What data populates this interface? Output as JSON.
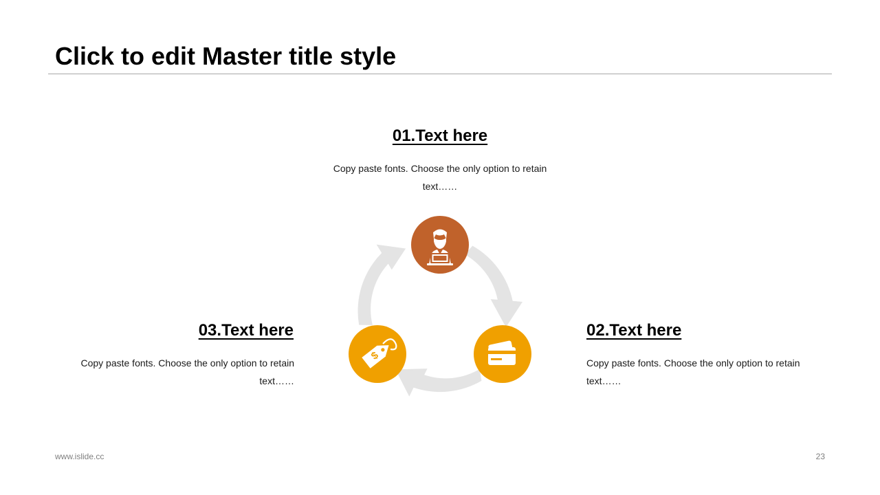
{
  "slide": {
    "title": "Click to edit Master title style"
  },
  "items": [
    {
      "heading": "01.Text here",
      "body": "Copy paste fonts. Choose the only option to retain text……",
      "icon": "person-laptop-icon",
      "color": "#c0622b"
    },
    {
      "heading": "02.Text here",
      "body": "Copy paste fonts. Choose the only option to retain text……",
      "icon": "credit-card-icon",
      "color": "#f0a000"
    },
    {
      "heading": "03.Text here",
      "body": "Copy paste fonts. Choose the only option to retain text……",
      "icon": "price-tag-icon",
      "color": "#f0a000"
    }
  ],
  "colors": {
    "arrow": "#e4e4e4",
    "rule": "#a6a6a6",
    "footer": "#7f7f7f"
  },
  "footer": {
    "website": "www.islide.cc",
    "page_number": "23"
  }
}
